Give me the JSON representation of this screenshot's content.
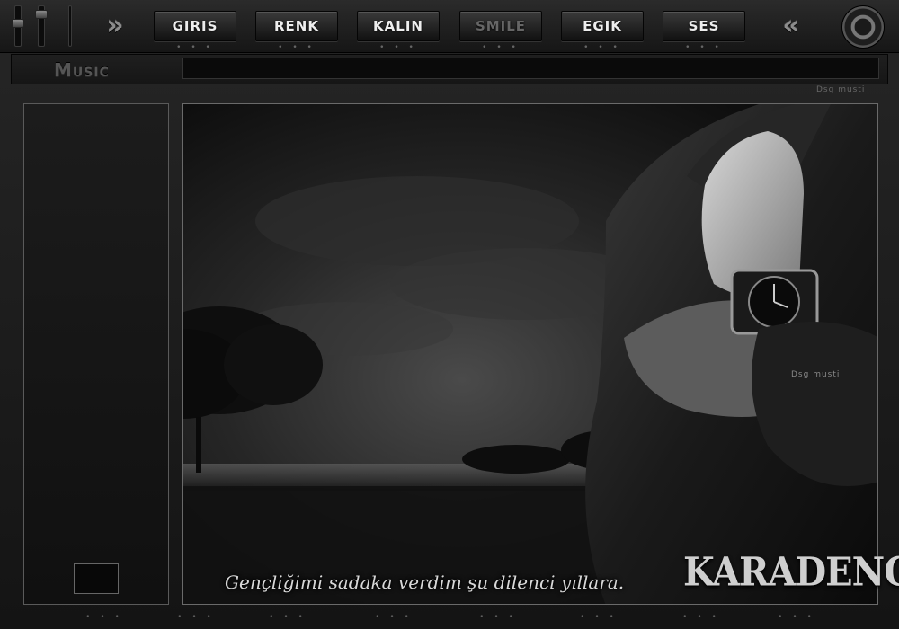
{
  "toolbar": {
    "buttons": [
      {
        "label": "Giris"
      },
      {
        "label": "Renk"
      },
      {
        "label": "Kalin"
      },
      {
        "label": "Smile"
      },
      {
        "label": "Egik"
      },
      {
        "label": "Ses"
      }
    ],
    "left_arrow": "»",
    "right_arrow": "«",
    "dots": "• • •"
  },
  "music": {
    "label": "Music",
    "signature": "Dsg musti"
  },
  "main": {
    "quote": "Gençliğimi sadaka verdim şu dilenci yıllara.",
    "logo": "KARADENGI",
    "signature": "Dsg musti"
  },
  "colors": {
    "background": "#1a1a1a",
    "button_text": "#eeeeee",
    "dim_text": "#666666"
  }
}
